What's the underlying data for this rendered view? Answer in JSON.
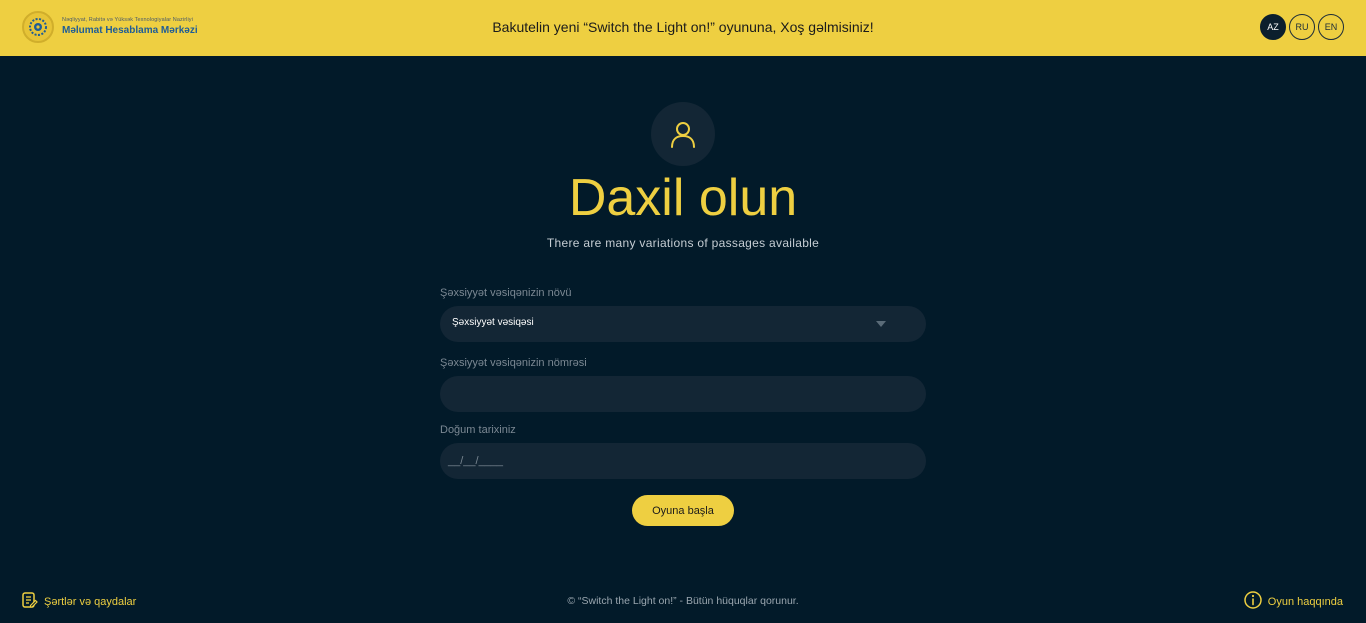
{
  "header": {
    "logo_line1": "Nəqliyyat, Rabitə və Yüksək Texnologiyalar Nazirliyi",
    "logo_line2": "Məlumat Hesablama Mərkəzi",
    "welcome": "Bakutelin yeni “Switch the Light on!” oyununa, Xoş gəlmisiniz!",
    "languages": [
      "AZ",
      "RU",
      "EN"
    ],
    "active_language": "AZ"
  },
  "login": {
    "title": "Daxil olun",
    "subtitle": "There are many variations of passages available",
    "doc_type_label": "Şəxsiyyət vəsiqənizin növü",
    "doc_type_value": "Şəxsiyyət vəsiqəsi",
    "doc_number_label": "Şəxsiyyət vəsiqənizin nömrəsi",
    "doc_number_value": "",
    "birth_label": "Doğum tarixiniz",
    "birth_placeholder": "__/__/____",
    "start_button": "Oyuna başla"
  },
  "footer": {
    "terms": "Şərtlər və qaydalar",
    "copyright": "© “Switch the Light on!” - Bütün hüquqlar qorunur.",
    "about": "Oyun haqqında"
  },
  "colors": {
    "accent": "#eecf41",
    "background": "#021a29",
    "field": "#132635"
  },
  "icons": {
    "logo": "emblem-icon",
    "avatar": "user-icon",
    "dropdown": "chevron-down-icon",
    "terms": "document-edit-icon",
    "about": "info-icon"
  }
}
